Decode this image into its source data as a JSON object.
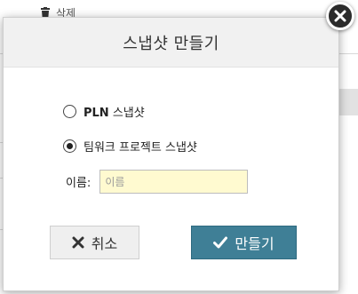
{
  "background": {
    "menu_item_label": "삭제"
  },
  "modal": {
    "title": "스냅샷 만들기",
    "options": [
      {
        "strong": "PLN",
        "rest": " 스냅샷",
        "checked": false
      },
      {
        "strong": "",
        "rest": "팀워크 프로젝트 스냅샷",
        "checked": true
      }
    ],
    "name_label": "이름:",
    "name_input": {
      "value": "",
      "placeholder": "이름"
    },
    "buttons": {
      "cancel_label": "취소",
      "create_label": "만들기"
    }
  },
  "icons": {
    "close": "close-icon",
    "cancel": "x-icon",
    "create": "check-icon",
    "background_menu": "trash-icon"
  },
  "colors": {
    "primary_button": "#3f7f96",
    "input_background": "#fffad0",
    "header_background": "#f1f1f1",
    "close_button": "#2b2b2b"
  }
}
